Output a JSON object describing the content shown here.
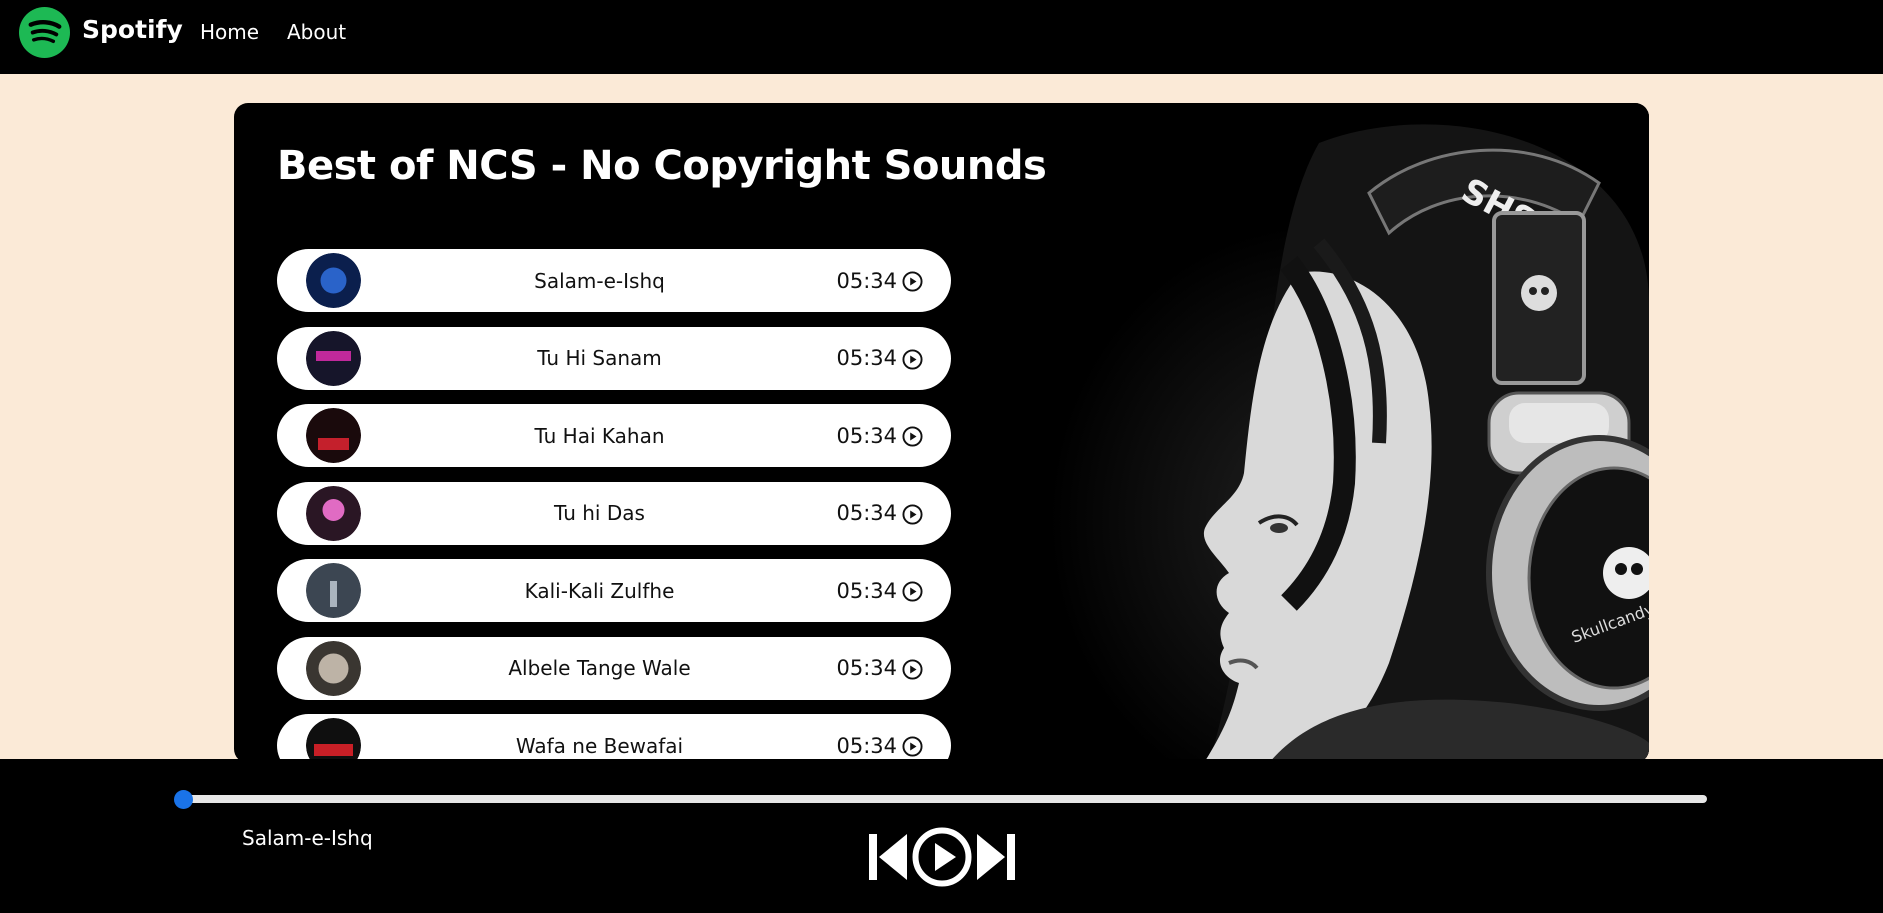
{
  "nav": {
    "brand": "Spotify",
    "links": [
      "Home",
      "About"
    ]
  },
  "playlist": {
    "title": "Best of NCS - No Copyright Sounds",
    "songs": [
      {
        "name": "Salam-e-Ishq",
        "duration": "05:34",
        "cover_colors": [
          "#0b1f4d",
          "#2a63c9"
        ]
      },
      {
        "name": "Tu Hi Sanam",
        "duration": "05:34",
        "cover_colors": [
          "#16152a",
          "#c0299b"
        ]
      },
      {
        "name": "Tu Hai Kahan",
        "duration": "05:34",
        "cover_colors": [
          "#1a0a0c",
          "#c4202c"
        ]
      },
      {
        "name": "Tu hi Das",
        "duration": "05:34",
        "cover_colors": [
          "#2a1624",
          "#e06bc3"
        ]
      },
      {
        "name": "Kali-Kali Zulfhe",
        "duration": "05:34",
        "cover_colors": [
          "#3c4652",
          "#aab4be"
        ]
      },
      {
        "name": "Albele Tange Wale",
        "duration": "05:34",
        "cover_colors": [
          "#3a3631",
          "#bdb3a6"
        ]
      },
      {
        "name": "Wafa ne Bewafai",
        "duration": "05:34",
        "cover_colors": [
          "#0f0f0f",
          "#c81f26"
        ]
      }
    ]
  },
  "player": {
    "current_song": "Salam-e-Ishq",
    "progress": 0,
    "icons": [
      "previous-icon",
      "play-icon",
      "next-icon"
    ]
  },
  "colors": {
    "accent": "#1db954",
    "progress": "#1a73e8",
    "page_bg": "#fbead7"
  }
}
